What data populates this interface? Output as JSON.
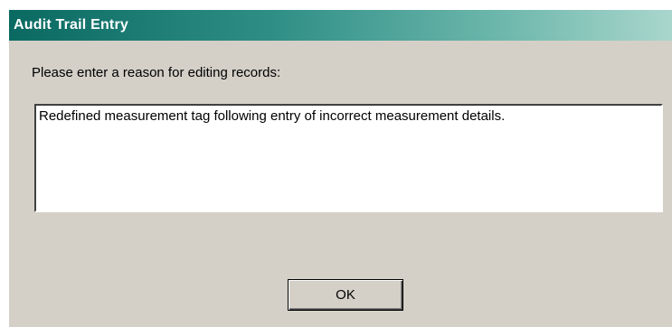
{
  "dialog": {
    "title": "Audit Trail Entry",
    "prompt": "Please enter a reason for editing records:",
    "reason_value": "Redefined measurement tag following entry of incorrect measurement details.",
    "ok_label": "OK"
  },
  "colors": {
    "title_bar_start": "#0a6a62",
    "title_bar_end": "#a9d6cc",
    "dialog_face": "#d4d0c8"
  }
}
